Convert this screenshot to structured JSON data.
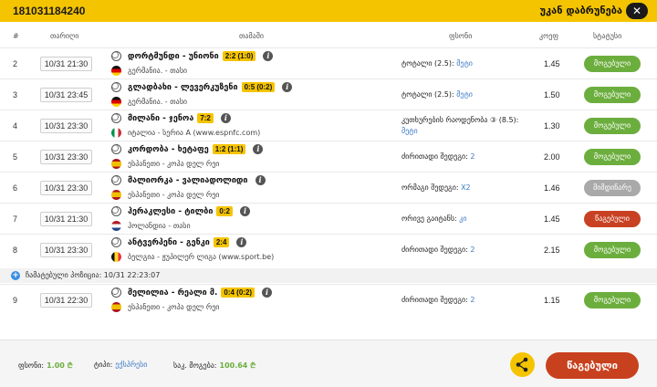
{
  "header": {
    "ticket_id": "181031184240",
    "back_label": "უკან დაბრუნება",
    "close_symbol": "✕"
  },
  "columns": {
    "num": "#",
    "date": "თარიღი",
    "event": "თამაში",
    "market": "ფსონი",
    "odd": "კოეფ",
    "status": "სტატუსი"
  },
  "rows": [
    {
      "num": "2",
      "date": "10/31 21:30",
      "match": "დორტმუნდი - უნიონი",
      "score": "2:2 (1:0)",
      "league": "გერმანია. - თასი",
      "flag": "germany",
      "market": "ტოტალი (2.5): ",
      "pick": "მეტი",
      "odd": "1.45",
      "status": "მოგებული",
      "status_kind": "win"
    },
    {
      "num": "3",
      "date": "10/31 23:45",
      "match": "გლადბახი - ლევერკუზენი",
      "score": "0:5 (0:2)",
      "league": "გერმანია. - თასი",
      "flag": "germany",
      "market": "ტოტალი (2.5): ",
      "pick": "მეტი",
      "odd": "1.50",
      "status": "მოგებული",
      "status_kind": "win"
    },
    {
      "num": "4",
      "date": "10/31 23:30",
      "match": "მილანი - ჯენოა",
      "score": "7:2",
      "league": "იტალია - სერია A (www.espnfc.com)",
      "flag": "italy",
      "market": "კუთხურების რაოდენობა ③ (8.5): ",
      "pick": "მეტი",
      "odd": "1.30",
      "status": "მოგებული",
      "status_kind": "win"
    },
    {
      "num": "5",
      "date": "10/31 23:30",
      "match": "კორდობა - ხეტაფე",
      "score": "1:2 (1:1)",
      "league": "ესპანეთი - კოპა დელ რეი",
      "flag": "spain",
      "market": "ძირითადი შედეგი: ",
      "pick": "2",
      "odd": "2.00",
      "status": "მოგებული",
      "status_kind": "win"
    },
    {
      "num": "6",
      "date": "10/31 23:30",
      "match": "მალიორკა - ვალიადოლიდი",
      "score": "",
      "league": "ესპანეთი - კოპა დელ რეი",
      "flag": "spain",
      "market": "ორმაგი შედეგი: ",
      "pick": "X2",
      "odd": "1.46",
      "status": "მიმდინარე",
      "status_kind": "pend"
    },
    {
      "num": "7",
      "date": "10/31 21:30",
      "match": "ჰერაკლესი - ტილბი",
      "score": "0:2",
      "league": "ჰოლანდია - თასი",
      "flag": "netherlands",
      "market": "ორივე გაიტანს: ",
      "pick": "კი",
      "odd": "1.45",
      "status": "წაგებული",
      "status_kind": "lose"
    },
    {
      "num": "8",
      "date": "10/31 23:30",
      "match": "ანტვერპენი - გენკი",
      "score": "2:4",
      "league": "ბელგია - ჟუპილერ ლიგა (www.sport.be)",
      "flag": "belgium",
      "market": "ძირითადი შედეგი: ",
      "pick": "2",
      "odd": "2.15",
      "status": "მოგებული",
      "status_kind": "win"
    },
    {
      "num": "9",
      "date": "10/31 22:30",
      "match": "მელილია - რეალი მ.",
      "score": "0:4 (0:2)",
      "league": "ესპანეთი - კოპა დელ რეი",
      "flag": "spain",
      "market": "ძირითადი შედეგი: ",
      "pick": "2",
      "odd": "1.15",
      "status": "მოგებული",
      "status_kind": "win"
    }
  ],
  "note": {
    "plus": "+",
    "text": "ჩამატებული პოზიცია: 10/31 22:23:07"
  },
  "footer": {
    "stake_label": "ფსონი:",
    "stake_value": "1.00 ₾",
    "type_label": "ტიპი:",
    "type_value": "ექსპრესი",
    "win_label": "საკ. მოგება:",
    "win_value": "100.64 ₾",
    "lost_button": "წაგებული"
  },
  "colors": {
    "accent": "#f5c400",
    "win": "#6cae3e",
    "lose": "#c8411e",
    "pending": "#a9a9a9",
    "link": "#3b7ac7"
  }
}
